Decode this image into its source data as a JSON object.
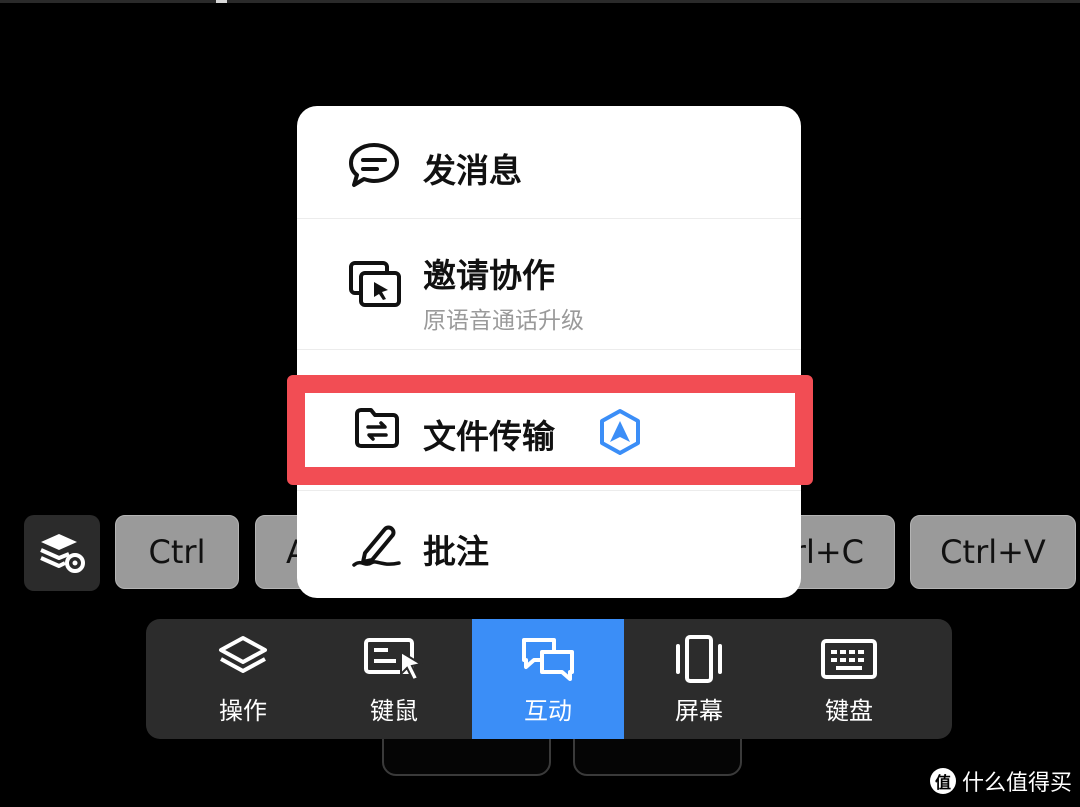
{
  "shortcuts": {
    "keys": [
      "Ctrl",
      "A",
      "rl+C",
      "Ctrl+V"
    ]
  },
  "menu": {
    "items": [
      {
        "label": "发消息",
        "icon": "chat-bubble-icon"
      },
      {
        "label": "邀请协作",
        "sublabel": "原语音通话升级",
        "icon": "screen-share-icon"
      },
      {
        "label": "文件传输",
        "icon": "folder-transfer-icon",
        "badge_icon": "premium-badge-icon"
      },
      {
        "label": "批注",
        "icon": "pen-annotate-icon"
      }
    ]
  },
  "toolbar": {
    "items": [
      {
        "label": "操作",
        "icon": "layers-icon"
      },
      {
        "label": "键鼠",
        "icon": "keyboard-mouse-icon"
      },
      {
        "label": "互动",
        "icon": "interaction-icon",
        "active": true
      },
      {
        "label": "屏幕",
        "icon": "screen-icon"
      },
      {
        "label": "键盘",
        "icon": "keyboard-icon"
      }
    ]
  },
  "watermark": {
    "symbol": "值",
    "text": "什么值得买"
  },
  "colors": {
    "active_tab": "#3b8ef7",
    "highlight": "#f24d54",
    "badge": "#3b8ef7"
  }
}
